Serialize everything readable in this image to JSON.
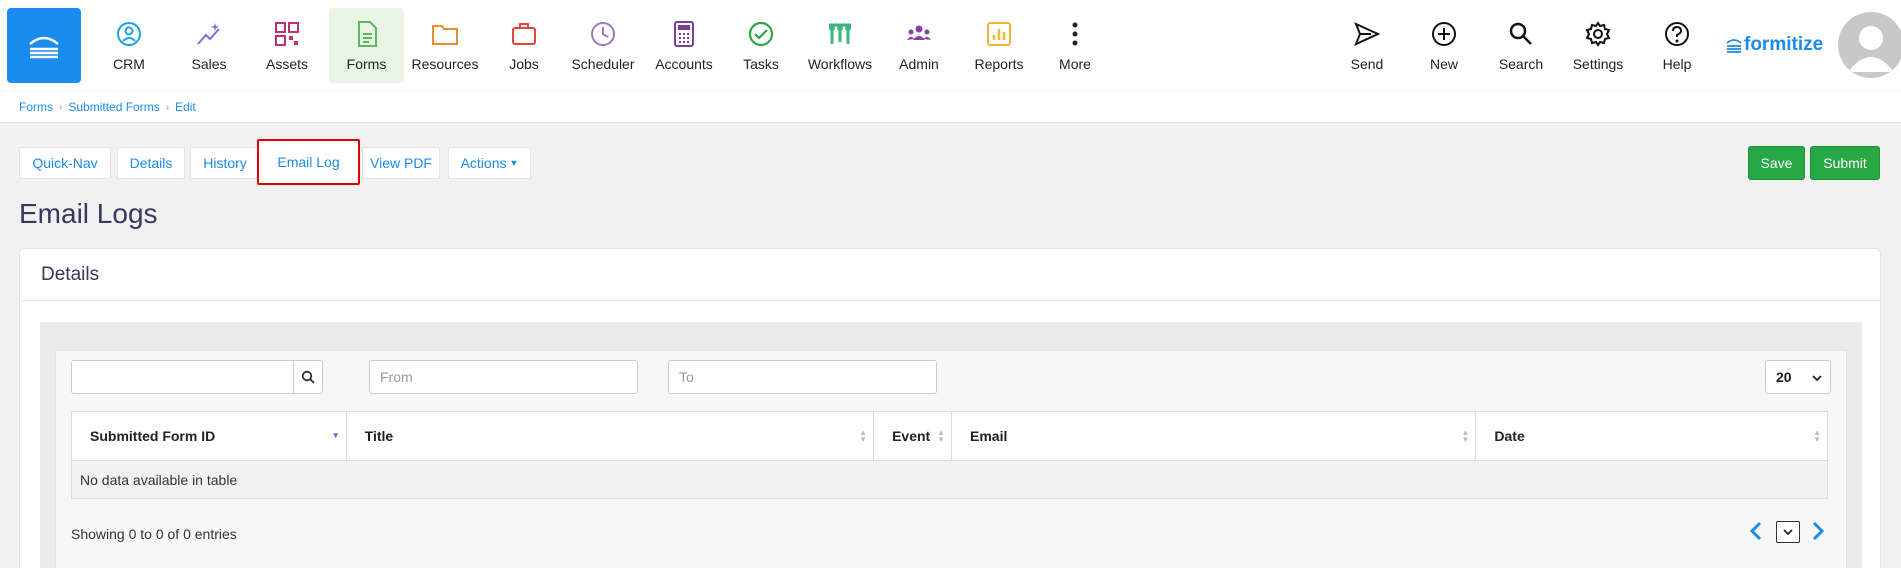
{
  "nav": {
    "items": [
      {
        "label": "CRM",
        "icon": "crm-icon",
        "color": "#1aa0e8"
      },
      {
        "label": "Sales",
        "icon": "sales-icon",
        "color": "#7b6fe0"
      },
      {
        "label": "Assets",
        "icon": "assets-icon",
        "color": "#c0306b"
      },
      {
        "label": "Forms",
        "icon": "forms-icon",
        "color": "#5cb85c"
      },
      {
        "label": "Resources",
        "icon": "resources-icon",
        "color": "#f08a2a"
      },
      {
        "label": "Jobs",
        "icon": "jobs-icon",
        "color": "#e04a3a"
      },
      {
        "label": "Scheduler",
        "icon": "scheduler-icon",
        "color": "#a07ab8"
      },
      {
        "label": "Accounts",
        "icon": "accounts-icon",
        "color": "#7a3f9a"
      },
      {
        "label": "Tasks",
        "icon": "tasks-icon",
        "color": "#27a844"
      },
      {
        "label": "Workflows",
        "icon": "workflows-icon",
        "color": "#3cb67a"
      },
      {
        "label": "Admin",
        "icon": "admin-icon",
        "color": "#8a3fa3"
      },
      {
        "label": "Reports",
        "icon": "reports-icon",
        "color": "#f2b632"
      },
      {
        "label": "More",
        "icon": "more-icon",
        "color": "#222222"
      }
    ],
    "right_items": [
      {
        "label": "Send",
        "icon": "send-icon"
      },
      {
        "label": "New",
        "icon": "new-icon"
      },
      {
        "label": "Search",
        "icon": "search-icon"
      },
      {
        "label": "Settings",
        "icon": "settings-icon"
      },
      {
        "label": "Help",
        "icon": "help-icon"
      }
    ],
    "active": "Forms",
    "brand": "formitize"
  },
  "breadcrumb": [
    "Forms",
    "Submitted Forms",
    "Edit"
  ],
  "tabs": [
    "Quick-Nav",
    "Details",
    "History",
    "Email Log",
    "View PDF",
    "Actions"
  ],
  "buttons": {
    "save": "Save",
    "submit": "Submit"
  },
  "page_title": "Email Logs",
  "panel": {
    "title": "Details"
  },
  "filters": {
    "search_placeholder": "",
    "from_placeholder": "From",
    "to_placeholder": "To",
    "page_size": "20"
  },
  "table": {
    "columns": [
      "Submitted Form ID",
      "Title",
      "Event",
      "Email",
      "Date"
    ],
    "empty_message": "No data available in table",
    "info": "Showing 0 to 0 of 0 entries"
  },
  "colors": {
    "accent": "#1b8bea",
    "success": "#28a745",
    "highlight": "#e00000"
  }
}
